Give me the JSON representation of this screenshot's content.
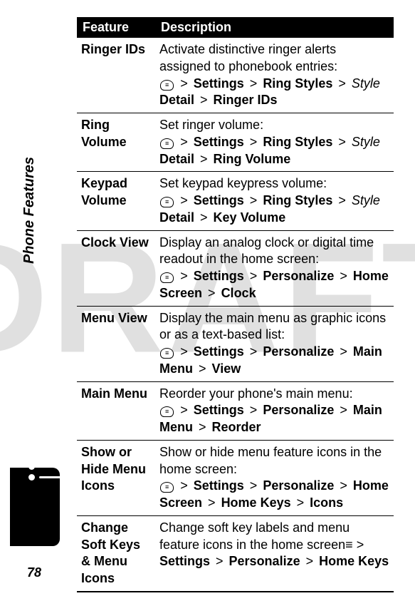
{
  "watermark": "DRAFT",
  "sideLabel": "Phone Features",
  "pageNumber": "78",
  "table": {
    "headers": [
      "Feature",
      "Description"
    ],
    "rows": [
      {
        "feature": "Ringer IDs",
        "desc": "Activate distinctive ringer alerts assigned to phonebook entries:",
        "path": [
          "KEY",
          "Settings",
          "Ring Styles",
          "ITALIC:Style",
          "Detail",
          "Ringer IDs"
        ]
      },
      {
        "feature": "Ring Volume",
        "desc": "Set ringer volume:",
        "path": [
          "KEY",
          "Settings",
          "Ring Styles",
          "ITALIC:Style",
          "Detail",
          "Ring Volume"
        ]
      },
      {
        "feature": "Keypad Volume",
        "desc": "Set keypad keypress volume:",
        "path": [
          "KEY",
          "Settings",
          "Ring Styles",
          "ITALIC:Style",
          "Detail",
          "Key Volume"
        ]
      },
      {
        "feature": "Clock View",
        "desc": "Display an analog clock or digital time readout in the home screen:",
        "path": [
          "KEY",
          "Settings",
          "Personalize",
          "Home Screen",
          "Clock"
        ]
      },
      {
        "feature": "Menu View",
        "desc": "Display the main menu as graphic icons or as a text-based list:",
        "path": [
          "KEY",
          "Settings",
          "Personalize",
          "Main Menu",
          "View"
        ]
      },
      {
        "feature": "Main Menu",
        "desc": "Reorder your phone's main menu:",
        "path": [
          "KEY",
          "Settings",
          "Personalize",
          "Main Menu",
          "Reorder"
        ]
      },
      {
        "feature": "Show or Hide Menu Icons",
        "desc": "Show or hide menu feature icons in the home screen:",
        "path": [
          "KEY",
          "Settings",
          "Personalize",
          "Home Screen",
          "Home Keys",
          "Icons"
        ]
      },
      {
        "feature": "Change Soft Keys & Menu Icons",
        "desc": "Change soft key labels and menu feature icons in the home screen",
        "inlineKeyAfterDesc": true,
        "path": [
          "Settings",
          "Personalize",
          "Home Keys"
        ]
      }
    ]
  },
  "menuKeyGlyph": "≡",
  "sep": ">"
}
